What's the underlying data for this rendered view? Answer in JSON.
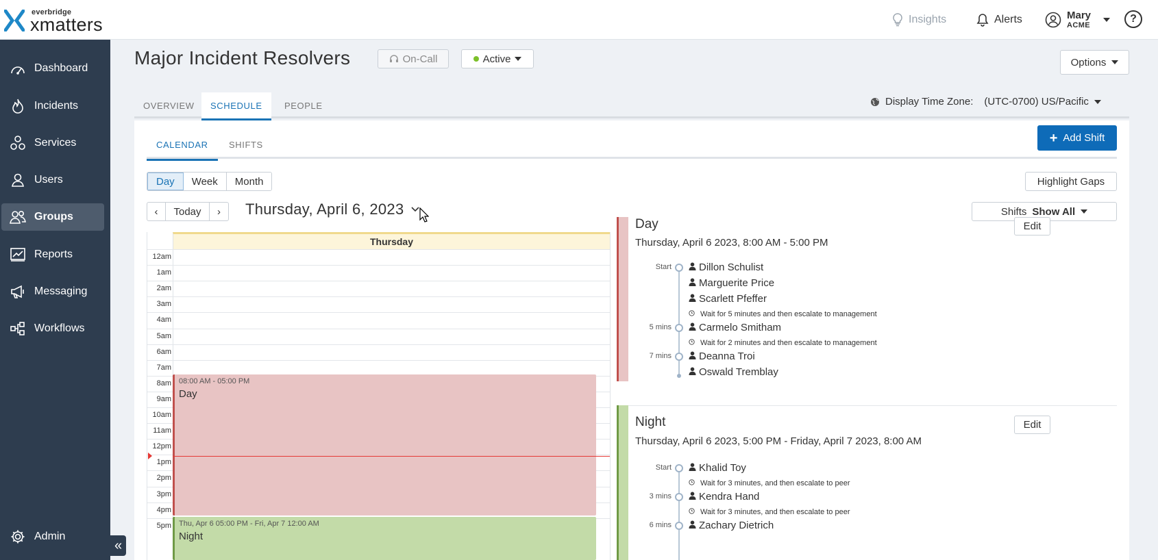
{
  "brand": {
    "company": "everbridge",
    "product": "xmatters"
  },
  "topbar": {
    "insights": "Insights",
    "alerts": "Alerts",
    "user_name": "Mary",
    "user_org": "ACME",
    "help": "?"
  },
  "sidebar": {
    "items": [
      {
        "label": "Dashboard",
        "icon": "dashboard-icon"
      },
      {
        "label": "Incidents",
        "icon": "flame-icon"
      },
      {
        "label": "Services",
        "icon": "services-icon"
      },
      {
        "label": "Users",
        "icon": "user-icon"
      },
      {
        "label": "Groups",
        "icon": "groups-icon",
        "active": true
      },
      {
        "label": "Reports",
        "icon": "reports-icon"
      },
      {
        "label": "Messaging",
        "icon": "megaphone-icon"
      },
      {
        "label": "Workflows",
        "icon": "workflow-icon"
      }
    ],
    "admin": "Admin",
    "collapse": "«"
  },
  "header": {
    "title": "Major Incident Resolvers",
    "oncall": "On-Call",
    "status": "Active",
    "status_color": "#7cc02a",
    "options": "Options"
  },
  "tabs": [
    "OVERVIEW",
    "SCHEDULE",
    "PEOPLE"
  ],
  "active_tab": "SCHEDULE",
  "timezone": {
    "label": "Display Time Zone:",
    "value": "(UTC-0700) US/Pacific"
  },
  "subtabs": [
    "CALENDAR",
    "SHIFTS"
  ],
  "add_shift": "Add Shift",
  "views": [
    "Day",
    "Week",
    "Month"
  ],
  "active_view": "Day",
  "highlight_gaps": "Highlight Gaps",
  "nav": {
    "prev": "‹",
    "today": "Today",
    "next": "›"
  },
  "date_title": "Thursday, April 6, 2023",
  "shifts_filter": {
    "label": "Shifts",
    "value": "Show All"
  },
  "calendar": {
    "day_header": "Thursday",
    "hours": [
      "12am",
      "1am",
      "2am",
      "3am",
      "4am",
      "5am",
      "6am",
      "7am",
      "8am",
      "9am",
      "10am",
      "11am",
      "12pm",
      "1pm",
      "2pm",
      "3pm",
      "4pm",
      "5pm"
    ],
    "blocks": [
      {
        "time": "08:00 AM - 05:00 PM",
        "name": "Day",
        "color": "#e8c4c4",
        "border": "#c0504d"
      },
      {
        "time": "Thu, Apr 6 05:00 PM - Fri, Apr 7 12:00 AM",
        "name": "Night",
        "color": "#c3dba8",
        "border": "#6f9a45"
      }
    ]
  },
  "details": [
    {
      "title": "Day",
      "subtitle": "Thursday, April 6 2023, 8:00 AM - 5:00 PM",
      "edit": "Edit",
      "bar_color": "#e8c4c4",
      "bar_border": "#c0504d",
      "rows": [
        {
          "label": "Start",
          "person": "Dillon Schulist"
        },
        {
          "label": "",
          "person": "Marguerite Price"
        },
        {
          "label": "",
          "person": "Scarlett Pfeffer"
        },
        {
          "wait": "Wait for 5 minutes and then escalate to management"
        },
        {
          "label": "5 mins",
          "person": "Carmelo Smitham"
        },
        {
          "wait": "Wait for 2 minutes and then escalate to management"
        },
        {
          "label": "7 mins",
          "person": "Deanna Troi"
        },
        {
          "label": "",
          "person": "Oswald Tremblay"
        }
      ]
    },
    {
      "title": "Night",
      "subtitle": "Thursday, April 6 2023, 5:00 PM - Friday, April 7 2023, 8:00 AM",
      "edit": "Edit",
      "bar_color": "#c3dba8",
      "bar_border": "#6f9a45",
      "rows": [
        {
          "label": "Start",
          "person": "Khalid Toy"
        },
        {
          "wait": "Wait for 3 minutes, and then escalate to peer"
        },
        {
          "label": "3 mins",
          "person": "Kendra Hand"
        },
        {
          "wait": "Wait for 3 minutes, and then escalate to peer"
        },
        {
          "label": "6 mins",
          "person": "Zachary Dietrich"
        }
      ]
    }
  ]
}
